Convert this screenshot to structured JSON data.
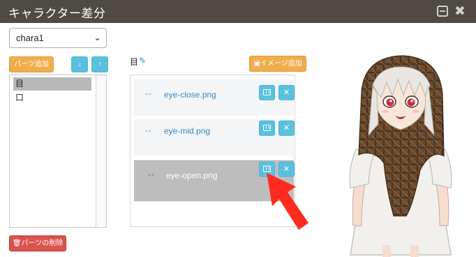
{
  "window": {
    "title": "キャラクター差分",
    "minimize_icon": "minimize-icon",
    "close_icon": "close-icon",
    "title_bg": "#4f4b44"
  },
  "character_select": {
    "value": "chara1",
    "icon": "chevron-down-icon"
  },
  "parts": {
    "add_label": "パーツ追加",
    "move_down_icon": "arrow-down-icon",
    "move_up_icon": "arrow-up-icon",
    "items": [
      {
        "label": "目",
        "selected": true
      },
      {
        "label": "口",
        "selected": false
      }
    ],
    "delete_label": "パーツの削除",
    "delete_icon": "trash-icon"
  },
  "images": {
    "header": "目",
    "edit_icon": "edit-icon",
    "add_label": "イメージ追加",
    "add_icon": "image-icon",
    "items": [
      {
        "handle": "--",
        "name": "eye-close.png",
        "selected": false
      },
      {
        "handle": "--",
        "name": "eye-mid.png",
        "selected": false
      },
      {
        "handle": "--",
        "name": "eye-open.png",
        "selected": true
      }
    ],
    "row_icons": [
      "film-icon",
      "times-icon"
    ]
  },
  "annotation": {
    "icon": "red-arrow-icon",
    "color": "#ff2a1f"
  },
  "colors": {
    "orange": "#f0ad4e",
    "blue": "#5bc0de",
    "red": "#d9534f",
    "selected": "#bdbdbd",
    "link": "#3a8bc5"
  }
}
